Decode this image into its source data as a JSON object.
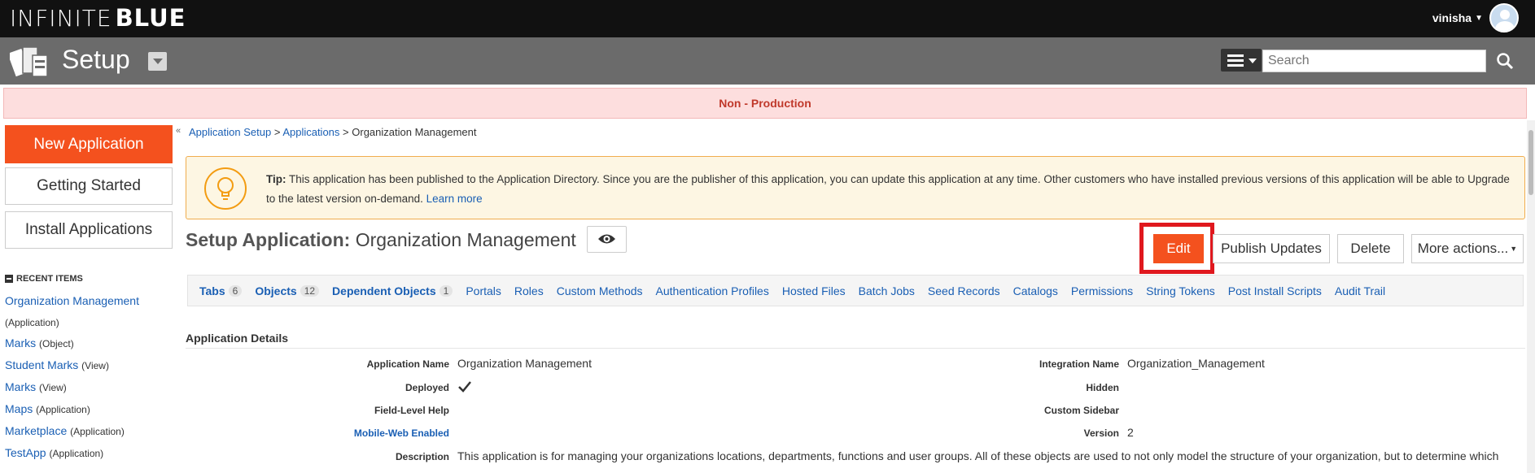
{
  "topbar": {
    "logo_thin": "INFINITE",
    "logo_bold": "BLUE",
    "username": "vinisha"
  },
  "setupbar": {
    "title": "Setup",
    "search_placeholder": "Search"
  },
  "banner": {
    "text": "Non - Production"
  },
  "sidebar": {
    "new_app": "New Application",
    "getting_started": "Getting Started",
    "install_apps": "Install Applications",
    "recent_header": "RECENT ITEMS",
    "recent": [
      {
        "name": "Organization Management",
        "type": "(Application)"
      },
      {
        "name": "Marks",
        "type": "(Object)"
      },
      {
        "name": "Student Marks",
        "type": "(View)"
      },
      {
        "name": "Marks",
        "type": "(View)"
      },
      {
        "name": "Maps",
        "type": "(Application)"
      },
      {
        "name": "Marketplace",
        "type": "(Application)"
      },
      {
        "name": "TestApp",
        "type": "(Application)"
      }
    ]
  },
  "breadcrumb": {
    "crumb1": "Application Setup",
    "sep": ">",
    "crumb2": "Applications",
    "current": "Organization Management"
  },
  "tip": {
    "label": "Tip:",
    "text": "This application has been published to the Application Directory. Since you are the publisher of this application, you can update this application at any time. Other customers who have installed previous versions of this application will be able to Upgrade to the latest version on-demand.",
    "link": "Learn more"
  },
  "page": {
    "title_prefix": "Setup Application:",
    "title_name": "Organization Management"
  },
  "actions": {
    "edit": "Edit",
    "publish": "Publish Updates",
    "delete": "Delete",
    "more": "More actions..."
  },
  "tabs": [
    {
      "label": "Tabs",
      "count": "6"
    },
    {
      "label": "Objects",
      "count": "12"
    },
    {
      "label": "Dependent Objects",
      "count": "1"
    },
    {
      "label": "Portals"
    },
    {
      "label": "Roles"
    },
    {
      "label": "Custom Methods"
    },
    {
      "label": "Authentication Profiles"
    },
    {
      "label": "Hosted Files"
    },
    {
      "label": "Batch Jobs"
    },
    {
      "label": "Seed Records"
    },
    {
      "label": "Catalogs"
    },
    {
      "label": "Permissions"
    },
    {
      "label": "String Tokens"
    },
    {
      "label": "Post Install Scripts"
    },
    {
      "label": "Audit Trail"
    }
  ],
  "details": {
    "section_title": "Application Details",
    "app_name_label": "Application Name",
    "app_name_value": "Organization Management",
    "deployed_label": "Deployed",
    "field_help_label": "Field-Level Help",
    "mobile_label": "Mobile-Web Enabled",
    "description_label": "Description",
    "description_value": "This application is for managing your organizations locations, departments, functions and user groups. All of these objects are used to not only model the structure of your organization, but to determine which",
    "integration_label": "Integration Name",
    "integration_value": "Organization_Management",
    "hidden_label": "Hidden",
    "sidebar_label": "Custom Sidebar",
    "version_label": "Version",
    "version_value": "2"
  }
}
